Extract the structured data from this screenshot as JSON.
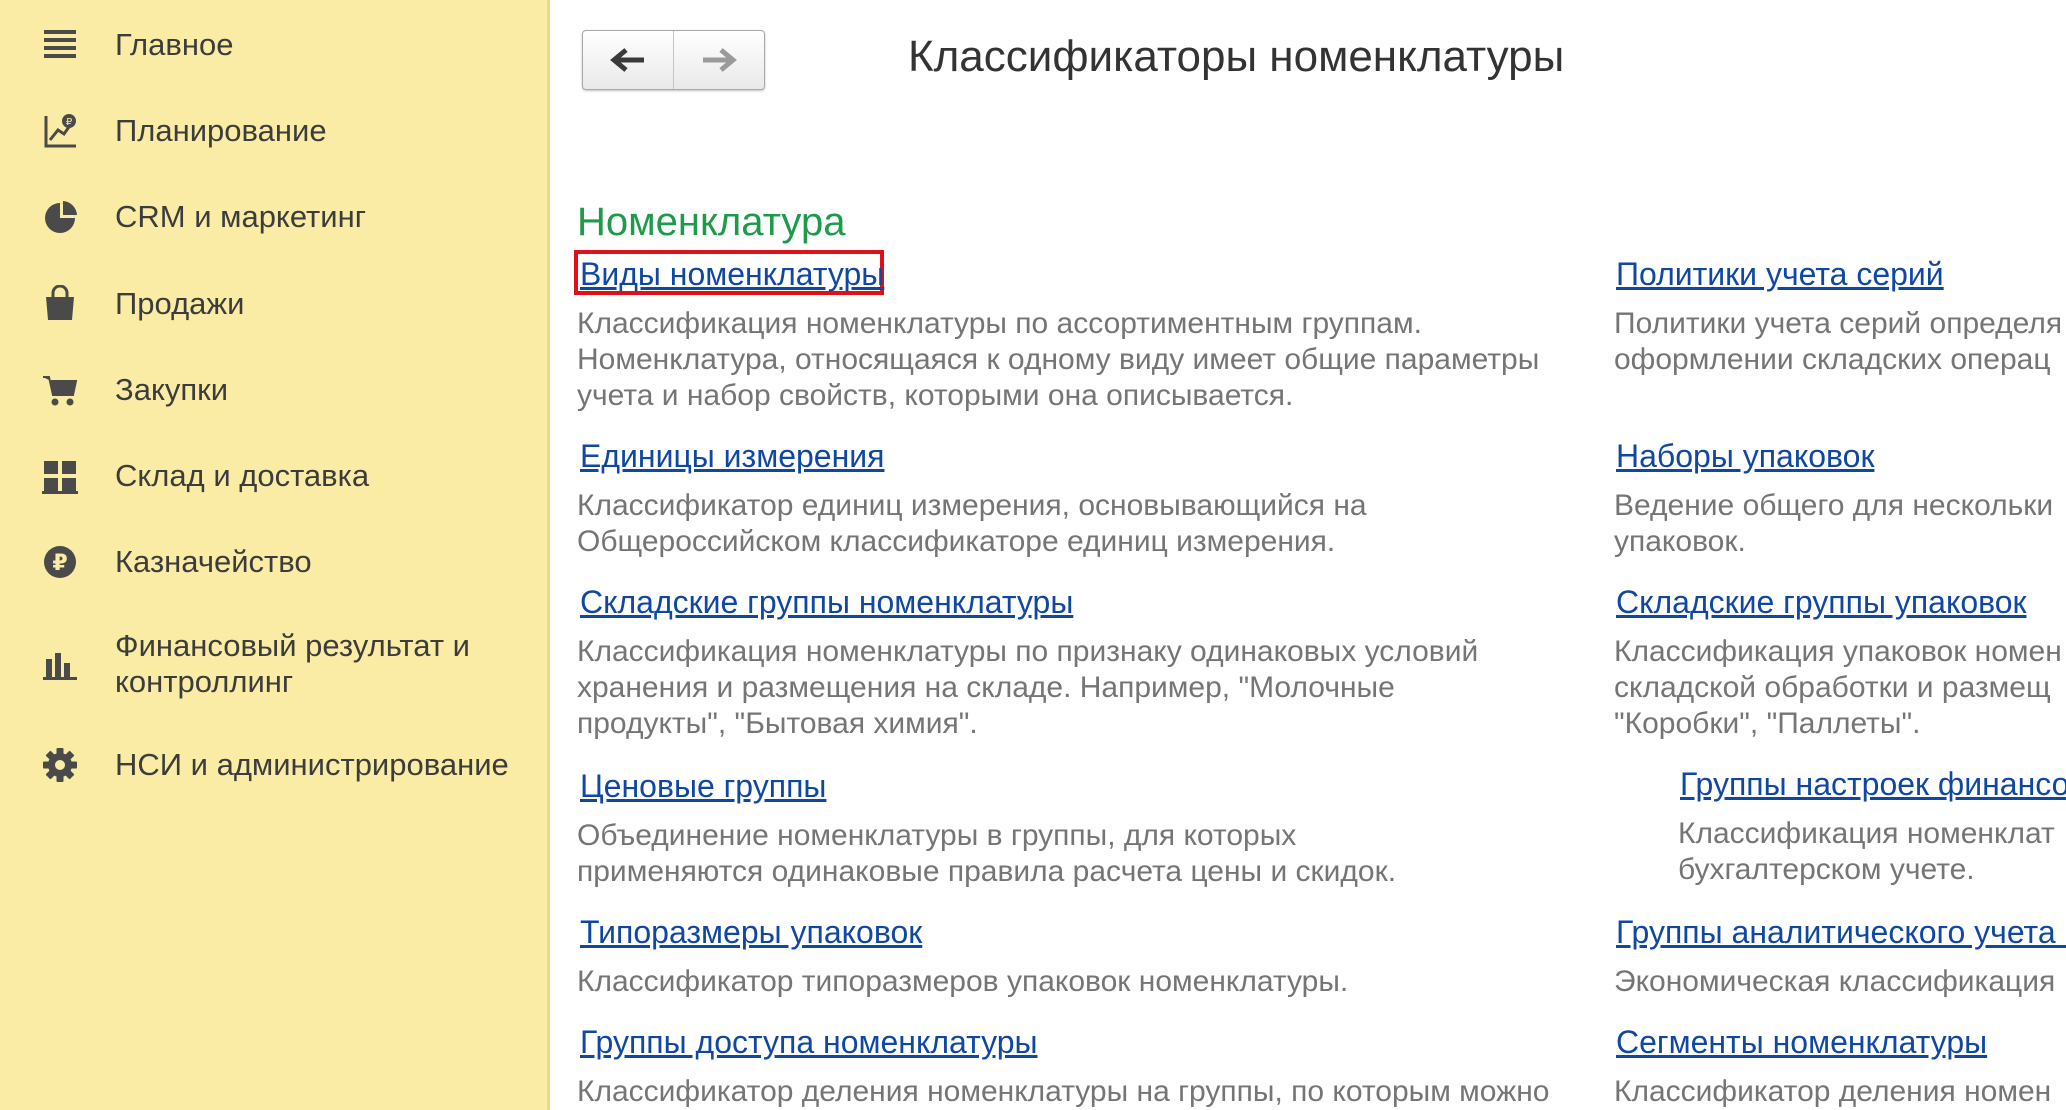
{
  "sidebar": {
    "items": [
      {
        "label": "Главное",
        "icon": "menu-lines-icon"
      },
      {
        "label": "Планирование",
        "icon": "planning-chart-icon"
      },
      {
        "label": "CRM и маркетинг",
        "icon": "pie-chart-icon"
      },
      {
        "label": "Продажи",
        "icon": "shopping-bag-icon"
      },
      {
        "label": "Закупки",
        "icon": "shopping-cart-icon"
      },
      {
        "label": "Склад и доставка",
        "icon": "warehouse-grid-icon"
      },
      {
        "label": "Казначейство",
        "icon": "ruble-coin-icon"
      },
      {
        "label": "Финансовый результат и",
        "label2": "контроллинг",
        "icon": "bar-chart-icon"
      },
      {
        "label": "НСИ и администрирование",
        "icon": "gear-icon"
      }
    ]
  },
  "header": {
    "title": "Классификаторы номенклатуры",
    "back": "back-arrow-icon",
    "forward": "forward-arrow-icon"
  },
  "section": {
    "title": "Номенклатура"
  },
  "left": [
    {
      "link": "Виды номенклатуры",
      "desc": [
        "Классификация номенклатуры по ассортиментным группам.",
        "Номенклатура, относящаяся к одному виду имеет общие параметры",
        "учета и набор свойств, которыми она описывается."
      ]
    },
    {
      "link": "Единицы измерения",
      "desc": [
        "Классификатор единиц измерения, основывающийся на",
        "Общероссийском классификаторе единиц измерения."
      ]
    },
    {
      "link": "Складские группы номенклатуры",
      "desc": [
        "Классификация номенклатуры по признаку одинаковых условий",
        "хранения и размещения на складе. Например, \"Молочные",
        "продукты\", \"Бытовая химия\"."
      ]
    },
    {
      "link": "Ценовые группы",
      "desc": [
        "Объединение номенклатуры в группы, для которых",
        "применяются одинаковые правила расчета цены и скидок."
      ]
    },
    {
      "link": "Типоразмеры упаковок",
      "desc": [
        "Классификатор типоразмеров упаковок номенклатуры."
      ]
    },
    {
      "link": "Группы доступа номенклатуры",
      "desc": [
        "Классификатор деления номенклатуры на группы, по которым можно"
      ]
    }
  ],
  "right": [
    {
      "link": "Политики учета серий",
      "desc": [
        "Политики учета серий определя",
        "оформлении складских операц"
      ]
    },
    {
      "link": "Наборы упаковок",
      "desc": [
        "Ведение общего для нескольки",
        "упаковок."
      ]
    },
    {
      "link": "Складские группы упаковок",
      "desc": [
        "Классификация упаковок номен",
        "складской обработки и размещ",
        "\"Коробки\", \"Паллеты\"."
      ]
    },
    {
      "link": "Группы настроек финансов",
      "desc": [
        "Классификация номенклат",
        "бухгалтерском учете."
      ]
    },
    {
      "link": "Группы аналитического учета н",
      "desc": [
        "Экономическая классификация"
      ]
    },
    {
      "link": "Сегменты номенклатуры",
      "desc": [
        "Классификатор деления номен"
      ]
    }
  ]
}
